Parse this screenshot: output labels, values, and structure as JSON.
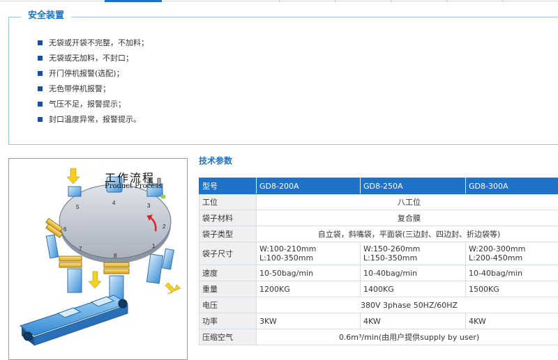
{
  "safety": {
    "title": "安全装置",
    "items": [
      "无袋或开袋不完整，不加料；",
      "无袋或无加料，不封口；",
      "开门停机报警(选配)；",
      "无色带停机报警；",
      "气压不足，报警提示；",
      "封口温度异常，报警提示。"
    ]
  },
  "process": {
    "title_cn": "工作流程",
    "title_en": "Product Process",
    "stations": [
      "1",
      "2",
      "3",
      "4",
      "5",
      "6",
      "7",
      "8"
    ]
  },
  "specs": {
    "title": "技术参数",
    "header": [
      "型号",
      "GD8-200A",
      "GD8-250A",
      "GD8-300A"
    ],
    "rows": [
      {
        "label": "工位",
        "merged": "八工位"
      },
      {
        "label": "袋子材料",
        "merged": "复合膜"
      },
      {
        "label": "袋子类型",
        "merged": "自立袋，斜嘴袋，平面袋(三边封、四边封、折边袋等)"
      },
      {
        "label": "袋子尺寸",
        "cells": [
          [
            "W:100-210mm",
            "L:100-350mm"
          ],
          [
            "W:150-260mm",
            "L:150-350mm"
          ],
          [
            "W:200-300mm",
            "L:200-450mm"
          ]
        ]
      },
      {
        "label": "速度",
        "cells": [
          [
            "10-50bag/min"
          ],
          [
            "10-40bag/min"
          ],
          [
            "10-40bag/min"
          ]
        ]
      },
      {
        "label": "重量",
        "cells": [
          [
            "1200KG"
          ],
          [
            "1400KG"
          ],
          [
            "1500KG"
          ]
        ]
      },
      {
        "label": "电压",
        "merged": "380V 3phase 50HZ/60HZ"
      },
      {
        "label": "功率",
        "cells": [
          [
            "3KW"
          ],
          [
            "4KW"
          ],
          [
            "4KW"
          ]
        ]
      },
      {
        "label": "压缩空气",
        "merged": "0.6m³/min(由用户提供supply by user)"
      }
    ]
  },
  "colors": {
    "accent": "#1a73c9",
    "header_bg": "#1e73c8",
    "bullet": "#1c4f98"
  }
}
